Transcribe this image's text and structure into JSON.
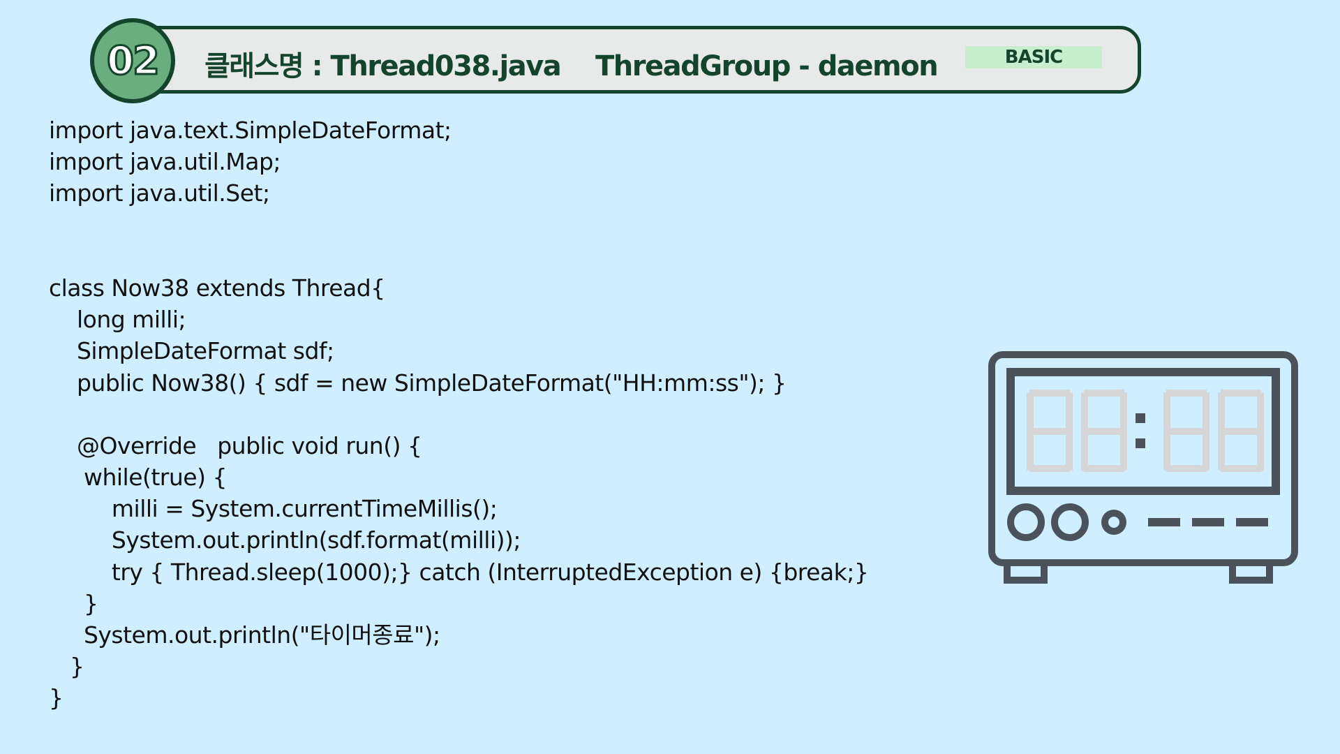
{
  "header": {
    "number": "02",
    "title": "클래스명 : Thread038.java    ThreadGroup - daemon",
    "level": "BASIC"
  },
  "code": {
    "lines": [
      "import java.text.SimpleDateFormat;",
      "import java.util.Map;",
      "import java.util.Set;",
      "",
      "",
      "class Now38 extends Thread{",
      "    long milli;",
      "    SimpleDateFormat sdf;",
      "    public Now38() { sdf = new SimpleDateFormat(\"HH:mm:ss\"); }",
      "",
      "    @Override   public void run() {",
      "     while(true) {",
      "         milli = System.currentTimeMillis();",
      "         System.out.println(sdf.format(milli));",
      "         try { Thread.sleep(1000);} catch (InterruptedException e) {break;}",
      "     }",
      "     System.out.println(\"타이머종료\");",
      "   }",
      "}"
    ]
  },
  "illustration": {
    "icon": "digital-clock-icon",
    "display": "88:88",
    "colors": {
      "frame": "#4a525c",
      "segments": "#d6d6d6"
    }
  },
  "colors": {
    "background": "#cfeeff",
    "header_border": "#14452c",
    "badge": "#6aad7e",
    "tag": "#c8eecd"
  }
}
